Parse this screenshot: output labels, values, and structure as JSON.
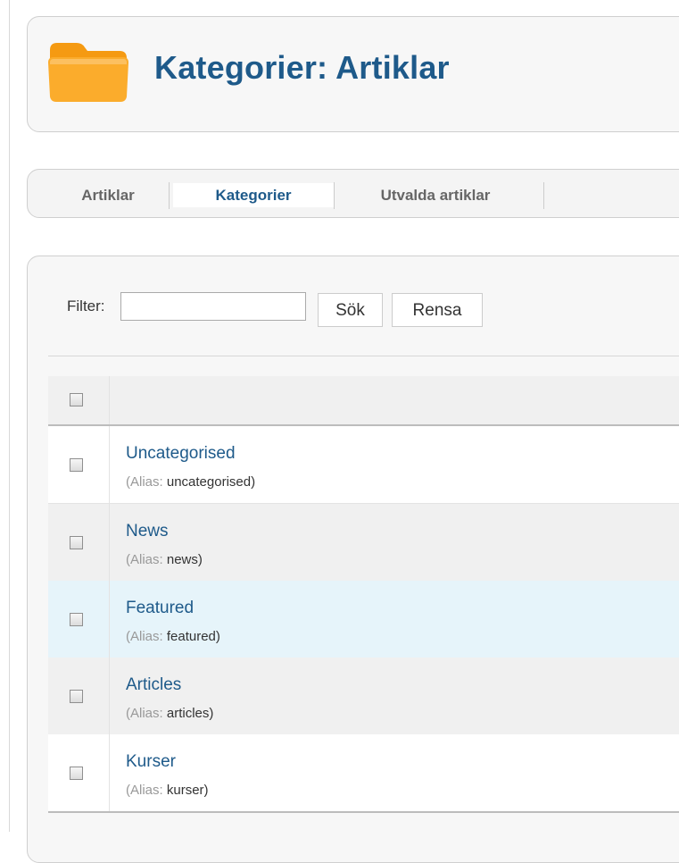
{
  "header": {
    "title": "Kategorier: Artiklar",
    "icon": "folder-icon"
  },
  "submenu": {
    "tabs": [
      {
        "label": "Artiklar",
        "active": false
      },
      {
        "label": "Kategorier",
        "active": true
      },
      {
        "label": "Utvalda artiklar",
        "active": false
      }
    ]
  },
  "filter": {
    "label": "Filter:",
    "value": "",
    "search_label": "Sök",
    "clear_label": "Rensa"
  },
  "table": {
    "rows": [
      {
        "title": "Uncategorised",
        "alias_label": "(Alias:",
        "alias": "uncategorised)"
      },
      {
        "title": "News",
        "alias_label": "(Alias:",
        "alias": "news)"
      },
      {
        "title": "Featured",
        "alias_label": "(Alias:",
        "alias": "featured)"
      },
      {
        "title": "Articles",
        "alias_label": "(Alias:",
        "alias": "articles)"
      },
      {
        "title": "Kurser",
        "alias_label": "(Alias:",
        "alias": "kurser)"
      }
    ]
  },
  "colors": {
    "title_blue": "#1e5a8a",
    "folder_orange": "#f9a21b",
    "row_alt": "#f0f0f0",
    "row_highlight": "#e6f4fa"
  }
}
